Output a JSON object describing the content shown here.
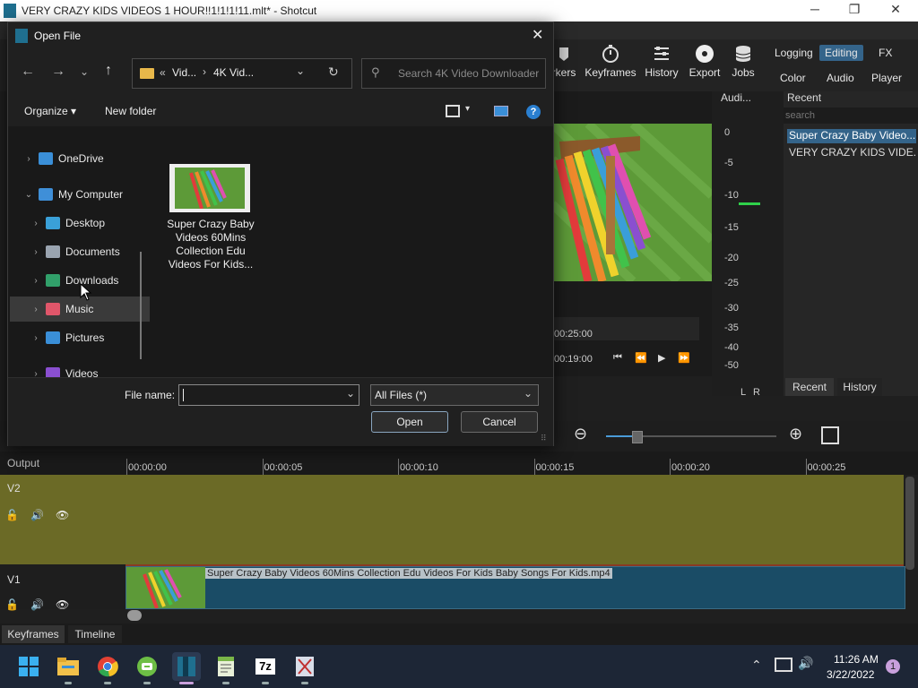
{
  "window": {
    "title": "VERY CRAZY KIDS VIDEOS 1 HOUR!!1!1!1!11.mlt* - Shotcut",
    "minimize": "─",
    "maximize": "❐",
    "close": "✕"
  },
  "toolbar": {
    "markers_label": "rkers",
    "keyframes_label": "Keyframes",
    "history_label": "History",
    "export_label": "Export",
    "jobs_label": "Jobs",
    "layouts": {
      "logging": "Logging",
      "editing": "Editing",
      "fx": "FX",
      "color": "Color",
      "audio": "Audio",
      "player": "Player"
    }
  },
  "audio_panel": {
    "title": "Audi...",
    "scale": [
      "0",
      "-5",
      "-10",
      "-15",
      "-20",
      "-25",
      "-30",
      "-35",
      "-40",
      "-50"
    ],
    "l": "L",
    "r": "R"
  },
  "recent_panel": {
    "title": "Recent",
    "search_placeholder": "search",
    "items": [
      "Super Crazy Baby Video...",
      "VERY CRAZY KIDS VIDE..."
    ],
    "tabs": [
      "Recent",
      "History"
    ]
  },
  "player": {
    "time1": "00:25:00",
    "time2": "00:19:00"
  },
  "dialog": {
    "title": "Open File",
    "path": {
      "prefix": "«",
      "seg1": "Vid...",
      "sep": "›",
      "seg2": "4K Vid..."
    },
    "search_placeholder": "Search 4K Video Downloader",
    "organize": "Organize",
    "new_folder": "New folder",
    "tree": [
      {
        "label": "OneDrive",
        "icon": "cloud-icon",
        "color": "#3a8fd8"
      },
      {
        "label": "My Computer",
        "icon": "computer-icon",
        "color": "#3f8fd8"
      },
      {
        "label": "Desktop",
        "icon": "desktop-icon",
        "color": "#3aa0d8"
      },
      {
        "label": "Documents",
        "icon": "documents-icon",
        "color": "#9aa4b0"
      },
      {
        "label": "Downloads",
        "icon": "download-icon",
        "color": "#31a06a"
      },
      {
        "label": "Music",
        "icon": "music-icon",
        "color": "#e0566a"
      },
      {
        "label": "Pictures",
        "icon": "pictures-icon",
        "color": "#3a8fd8"
      },
      {
        "label": "Videos",
        "icon": "videos-icon",
        "color": "#8a4fd0"
      }
    ],
    "file": {
      "name": "Super Crazy Baby Videos 60Mins Collection   Edu Videos For Kids..."
    },
    "filename_label": "File name:",
    "filename_value": "",
    "filetype": "All Files (*)",
    "open_button": "Open",
    "cancel_button": "Cancel"
  },
  "timeline": {
    "output_label": "Output",
    "ruler": [
      "00:00:00",
      "00:00:05",
      "00:00:10",
      "00:00:15",
      "00:00:20",
      "00:00:25"
    ],
    "v2": "V2",
    "v1": "V1",
    "clip_name": "Super Crazy Baby Videos 60Mins Collection   Edu Videos For Kids Baby Songs For Kids.mp4",
    "tabs": [
      "Keyframes",
      "Timeline"
    ],
    "zoom_level": 0.18
  },
  "taskbar": {
    "time": "11:26 AM",
    "date": "3/22/2022",
    "notifications": "1",
    "sevenzip": "7z"
  },
  "colors": {
    "accent": "#34648a",
    "v2_track": "#6b6a26",
    "v1_clip": "#1a4c66",
    "taskbar": "#1d2636"
  }
}
